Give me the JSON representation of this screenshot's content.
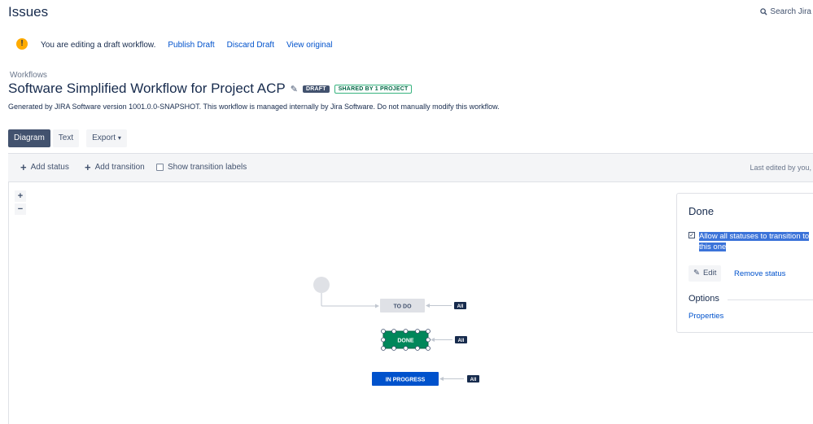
{
  "header": {
    "title": "Issues",
    "search_label": "Search Jira"
  },
  "draft_bar": {
    "message": "You are editing a draft workflow.",
    "publish": "Publish Draft",
    "discard": "Discard Draft",
    "view_original": "View original"
  },
  "workflow": {
    "breadcrumb": "Workflows",
    "title": "Software Simplified Workflow for Project ACP",
    "draft_badge": "DRAFT",
    "shared_badge": "SHARED BY 1 PROJECT",
    "description": "Generated by JIRA Software version 1001.0.0-SNAPSHOT. This workflow is managed internally by Jira Software. Do not manually modify this workflow."
  },
  "view_tabs": {
    "diagram": "Diagram",
    "text": "Text",
    "export": "Export"
  },
  "toolbar": {
    "add_status": "Add status",
    "add_transition": "Add transition",
    "show_labels": "Show transition labels",
    "last_edited": "Last edited by you,"
  },
  "zoom": {
    "in": "+",
    "out": "−"
  },
  "diagram": {
    "statuses": [
      {
        "name": "TO DO",
        "color": "#dfe1e6",
        "text_color": "#42526e"
      },
      {
        "name": "DONE",
        "color": "#00875a",
        "text_color": "#ffffff"
      },
      {
        "name": "IN PROGRESS",
        "color": "#0052cc",
        "text_color": "#ffffff"
      }
    ],
    "all_label": "All"
  },
  "panel": {
    "title": "Done",
    "allow_all_checked": true,
    "allow_all_label": "Allow all statuses to transition to this one",
    "edit": "Edit",
    "remove": "Remove status",
    "options_title": "Options",
    "properties": "Properties"
  },
  "colors": {
    "link": "#0052cc",
    "warning": "#ffab00",
    "selection": "#3b73d9"
  }
}
